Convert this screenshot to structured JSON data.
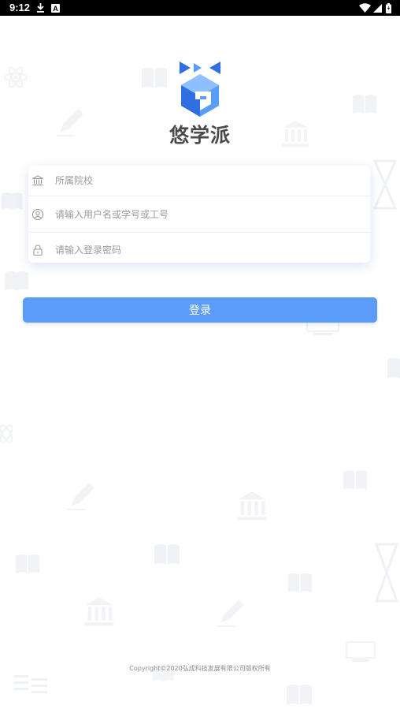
{
  "status_bar": {
    "time": "9:12",
    "icons": [
      "download-icon",
      "text-notification-icon",
      "wifi-icon",
      "signal-icon",
      "battery-icon"
    ]
  },
  "app": {
    "name": "悠学派",
    "accent_color": "#5b9cf8"
  },
  "form": {
    "school": {
      "placeholder": "所属院校",
      "value": "",
      "icon": "school-building-icon"
    },
    "username": {
      "placeholder": "请输入用户名或学号或工号",
      "value": "",
      "icon": "user-icon"
    },
    "password": {
      "placeholder": "请输入登录密码",
      "value": "",
      "icon": "lock-icon"
    }
  },
  "login_button": {
    "label": "登录"
  },
  "footer": {
    "copyright": "Copyright©2020弘成科技发展有限公司版权所有"
  }
}
